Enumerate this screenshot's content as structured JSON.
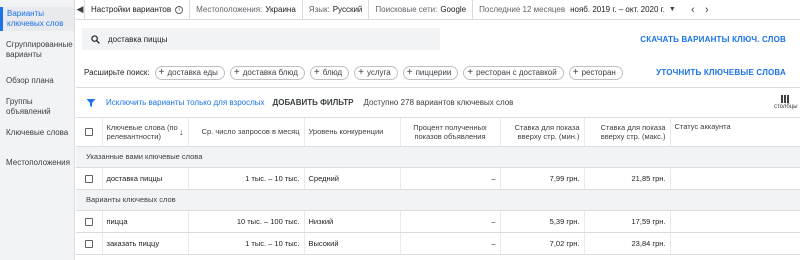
{
  "sidebar": {
    "items": [
      {
        "label": "Варианты ключевых слов",
        "active": true
      },
      {
        "label": "Сгруппированные варианты",
        "active": false
      },
      {
        "label": "Обзор плана",
        "active": false
      },
      {
        "label": "Группы объявлений",
        "active": false
      },
      {
        "label": "Ключевые слова",
        "active": false
      },
      {
        "label": "Местоположения",
        "active": false
      }
    ]
  },
  "topbar": {
    "title": "Настройки вариантов",
    "location_label": "Местоположения:",
    "location_value": "Украина",
    "language_label": "Язык:",
    "language_value": "Русский",
    "network_label": "Поисковые сети:",
    "network_value": "Google",
    "period_label": "Последние 12 месяцев",
    "period_value": "нояб. 2019 г. – окт. 2020 г."
  },
  "search": {
    "query": "доставка пиццы",
    "download_label": "СКАЧАТЬ ВАРИАНТЫ КЛЮЧ. СЛОВ"
  },
  "broaden": {
    "label": "Расширьте поиск:",
    "chips": [
      "доставка еды",
      "доставка блюд",
      "блюд",
      "услуга",
      "пиццерии",
      "ресторан с доставкой",
      "ресторан"
    ],
    "refine_label": "УТОЧНИТЬ КЛЮЧЕВЫЕ СЛОВА"
  },
  "filters": {
    "adult_exclusion": "Исключить варианты только для взрослых",
    "add_filter": "ДОБАВИТЬ ФИЛЬТР",
    "available": "Доступно 278 вариантов ключевых слов",
    "columns_label": "столбцы"
  },
  "table": {
    "headers": {
      "keyword": "Ключевые слова (по релевантности)",
      "avg_searches": "Ср. число запросов в месяц",
      "competition": "Уровень конкуренции",
      "impr_share": "Процент полученных показов объявления",
      "bid_low": "Ставка для показа вверху стр. (мин.)",
      "bid_high": "Ставка для показа вверху стр. (макс.)",
      "account_status": "Статус аккаунта"
    },
    "group1": "Указанные вами ключевые слова",
    "group2": "Варианты ключевых слов",
    "rows": [
      {
        "keyword": "доставка пиццы",
        "avg": "1 тыс. – 10 тыс.",
        "competition": "Средний",
        "share": "–",
        "low": "7,99 грн.",
        "high": "21,85 грн.",
        "status": ""
      },
      {
        "keyword": "пицца",
        "avg": "10 тыс. – 100 тыс.",
        "competition": "Низкий",
        "share": "–",
        "low": "5,39 грн.",
        "high": "17,59 грн.",
        "status": ""
      },
      {
        "keyword": "заказать пиццу",
        "avg": "1 тыс. – 10 тыс.",
        "competition": "Высокий",
        "share": "–",
        "low": "7,02 грн.",
        "high": "23,84 грн.",
        "status": ""
      }
    ]
  },
  "colors": {
    "accent": "#1a73e8",
    "sidebar_bg": "#f1f3f4",
    "border": "#dadce0"
  },
  "icons": [
    "info-icon",
    "chevron-down-icon",
    "chevron-left-icon",
    "chevron-right-icon",
    "search-icon",
    "plus-icon",
    "filter-icon",
    "sort-arrow-icon",
    "columns-icon"
  ]
}
